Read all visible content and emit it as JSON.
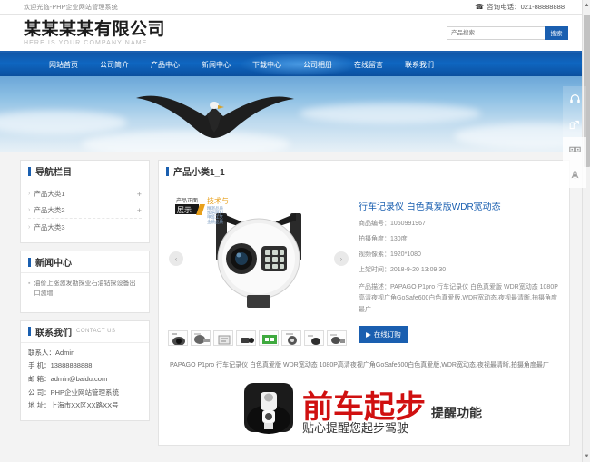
{
  "topbar": {
    "welcome": "欢迎光临-PHP企业网站管理系统",
    "phone_icon": "phone-icon",
    "phone_label": "咨询电话：021-88888888"
  },
  "header": {
    "logo_cn": "某某某某有限公司",
    "logo_en": "HERE IS YOUR COMPANY NAME",
    "search_placeholder": "产品搜索",
    "search_value": "",
    "search_button": "搜索"
  },
  "nav": {
    "items": [
      {
        "label": "网站首页"
      },
      {
        "label": "公司简介"
      },
      {
        "label": "产品中心"
      },
      {
        "label": "新闻中心"
      },
      {
        "label": "下载中心"
      },
      {
        "label": "公司相册"
      },
      {
        "label": "在线留言"
      },
      {
        "label": "联系我们"
      }
    ]
  },
  "sidebar": {
    "nav_panel": {
      "title": "导航栏目",
      "items": [
        {
          "label": "产品大类1",
          "expand": "+"
        },
        {
          "label": "产品大类2",
          "expand": "+"
        },
        {
          "label": "产品大类3",
          "expand": ""
        }
      ]
    },
    "news_panel": {
      "title": "新闻中心",
      "items": [
        {
          "label": "油价上涨激发勘探业石油钻探设备出口激增"
        }
      ]
    },
    "contact_panel": {
      "title": "联系我们",
      "title_en": "CONTACT US",
      "lines": [
        "联系人：Admin",
        "手 机：13888888888",
        "邮 箱：admin@baidu.com",
        "公 司：PHP企业网站管理系统",
        "地 址：上海市XX区XX路XX号"
      ]
    }
  },
  "product": {
    "panel_title": "产品小类1_1",
    "title": "行车记录仪 白色真爱版WDR宽动态",
    "specs": [
      "商品编号：1060991967",
      "拍摄角度：130度",
      "视频像素：1920*1080",
      "上架时间：2018-9-20 13:09:30"
    ],
    "description": "产品描述：PAPAGO P1pro 行车记录仪 白色真爱版 WDR宽动态 1080P高清夜视广角GoSafe600白色真爱版,WDR宽动态,夜视最清晰,拍摄角度最广",
    "order_button": "在线订购",
    "prev_arrow": "‹",
    "next_arrow": "›",
    "promo_badge_line1": "产品正面",
    "promo_badge_line2": "展示",
    "promo_badge_right1": "技术与",
    "promo_badge_right2": "精湛品质",
    "thumbnails": [
      {
        "label": "thumb-1"
      },
      {
        "label": "thumb-2"
      },
      {
        "label": "thumb-3"
      },
      {
        "label": "thumb-4"
      },
      {
        "label": "thumb-5"
      },
      {
        "label": "thumb-6"
      },
      {
        "label": "thumb-7"
      },
      {
        "label": "thumb-8"
      }
    ],
    "bottom_description": "PAPAGO P1pro 行车记录仪 白色真爱版 WDR宽动态 1080P高清夜视广角GoSafe600白色真爱版,WDR宽动态,夜视最清晰,拍摄角度最广",
    "banner": {
      "headline": "前车起步",
      "headline_suffix": "提醒功能",
      "subline": "贴心提醒您起步驾驶"
    }
  },
  "floatbar": {
    "items": [
      {
        "icon": "headset-icon"
      },
      {
        "icon": "share-icon"
      },
      {
        "icon": "qrcode-icon"
      },
      {
        "icon": "rocket-icon"
      }
    ]
  },
  "colors": {
    "brand_blue": "#1a5fb0",
    "nav_blue": "#0f66c0",
    "banner_red": "#d01010"
  }
}
